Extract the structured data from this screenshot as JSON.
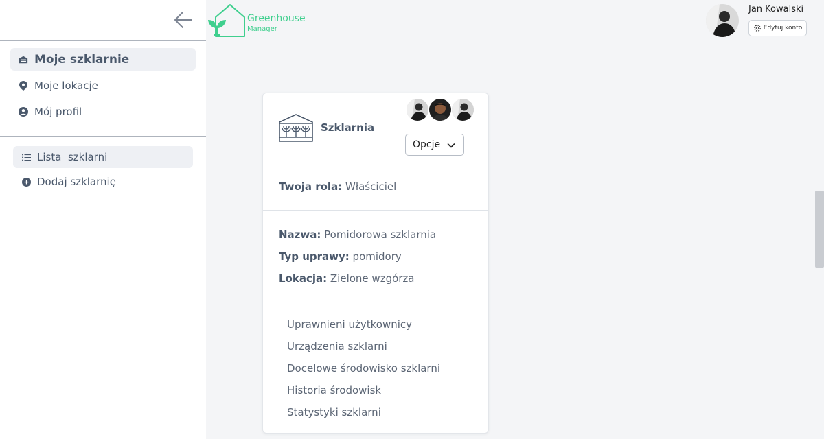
{
  "brand": {
    "title": "Greenhouse",
    "subtitle": "Manager",
    "color": "#3fcf8e"
  },
  "user": {
    "name": "Jan Kowalski",
    "edit_label": "Edytuj konto"
  },
  "sidebar": {
    "main_items": [
      {
        "label": "Moje szklarnie",
        "icon": "warehouse-icon",
        "active": true
      },
      {
        "label": "Moje lokacje",
        "icon": "map-pin-icon"
      },
      {
        "label": "Mój profil",
        "icon": "user-circle-icon"
      }
    ],
    "sub_items": [
      {
        "label": "Lista  szklarni",
        "icon": "list-icon",
        "active": true
      },
      {
        "label": "Dodaj szklarnię",
        "icon": "plus-circle-icon"
      }
    ]
  },
  "card": {
    "title": "Szklarnia",
    "options_label": "Opcje",
    "role_label": "Twoja rola:",
    "role_value": "Właściciel",
    "fields": [
      {
        "label": "Nazwa:",
        "value": "Pomidorowa szklarnia"
      },
      {
        "label": "Typ uprawy:",
        "value": "pomidory"
      },
      {
        "label": "Lokacja:",
        "value": "Zielone wzgórza"
      }
    ],
    "links": [
      "Uprawnieni użytkownicy",
      "Urządzenia szklarni",
      "Docelowe środowisko szklarni",
      "Historia środowisk",
      "Statystyki szklarni"
    ]
  }
}
